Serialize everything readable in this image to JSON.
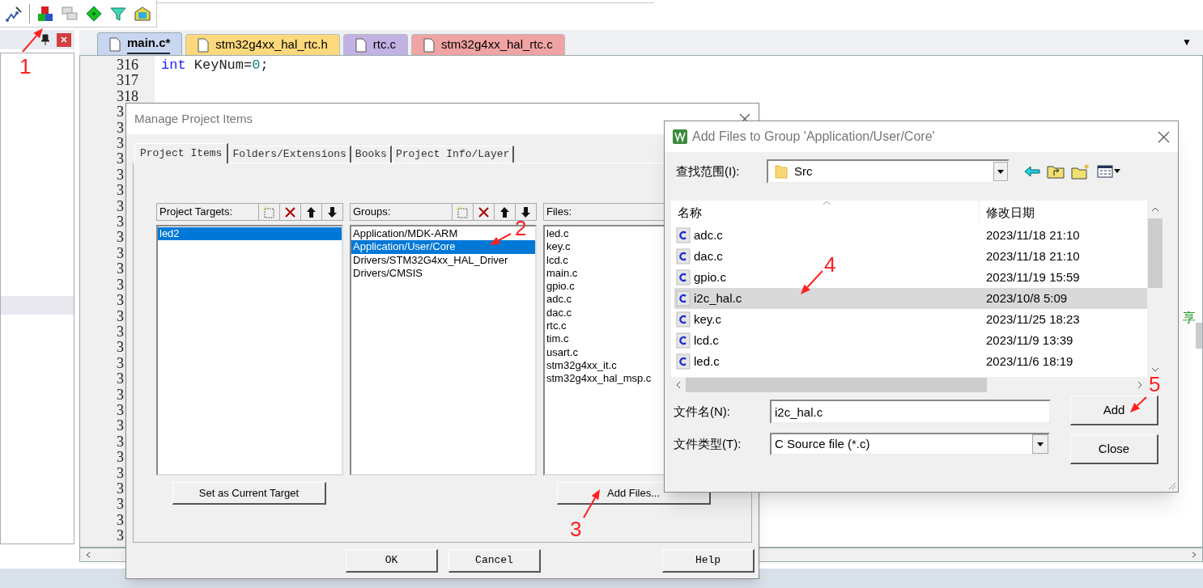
{
  "editor_tabs": [
    {
      "label": "main.c*",
      "selected": true,
      "color": "#c9d6f2"
    },
    {
      "label": "stm32g4xx_hal_rtc.h",
      "selected": false,
      "color": "#fcd97c"
    },
    {
      "label": "rtc.c",
      "selected": false,
      "color": "#c2b2e4"
    },
    {
      "label": "stm32g4xx_hal_rtc.c",
      "selected": false,
      "color": "#f0a3a3"
    }
  ],
  "tab_menu": "▼",
  "editor": {
    "line_numbers": [
      "316",
      "317",
      "318",
      "3",
      "3",
      "3",
      "3",
      "3",
      "3",
      "3",
      "3",
      "3",
      "3",
      "3",
      "3",
      "3",
      "3",
      "3",
      "3",
      "3",
      "3",
      "3",
      "3",
      "3",
      "3",
      "3",
      "3",
      "3",
      "3",
      "3",
      "3"
    ],
    "code": [
      {
        "text": "int",
        "kind": "keyword"
      },
      {
        "text": " KeyNum=",
        "kind": "plain"
      },
      {
        "text": "0",
        "kind": "number"
      },
      {
        "text": ";",
        "kind": "plain"
      }
    ],
    "side_text": "享"
  },
  "manage_dialog": {
    "title": "Manage Project Items",
    "tabs": [
      {
        "label": "Project Items",
        "selected": true
      },
      {
        "label": "Folders/Extensions",
        "selected": false
      },
      {
        "label": "Books",
        "selected": false
      },
      {
        "label": "Project Info/Layer",
        "selected": false
      }
    ],
    "targets": {
      "label": "Project Targets:",
      "items": [
        {
          "label": "led2",
          "selected": true
        }
      ]
    },
    "groups": {
      "label": "Groups:",
      "items": [
        {
          "label": "Application/MDK-ARM",
          "selected": false
        },
        {
          "label": "Application/User/Core",
          "selected": true
        },
        {
          "label": "Drivers/STM32G4xx_HAL_Driver",
          "selected": false
        },
        {
          "label": "Drivers/CMSIS",
          "selected": false
        }
      ]
    },
    "files": {
      "label": "Files:",
      "items": [
        "led.c",
        "key.c",
        "lcd.c",
        "main.c",
        "gpio.c",
        "adc.c",
        "dac.c",
        "rtc.c",
        "tim.c",
        "usart.c",
        "stm32g4xx_it.c",
        "stm32g4xx_hal_msp.c"
      ]
    },
    "set_target_button": "Set as Current Target",
    "add_files_button": "Add Files...",
    "buttons": [
      "OK",
      "Cancel",
      "Help"
    ]
  },
  "add_files_dialog": {
    "title": "Add Files to Group 'Application/User/Core'",
    "look_in_label": "查找范围(I):",
    "look_in_value": "Src",
    "columns": [
      "名称",
      "修改日期"
    ],
    "rows": [
      {
        "name": "adc.c",
        "date": "2023/11/18 21:10",
        "selected": false
      },
      {
        "name": "dac.c",
        "date": "2023/11/18 21:10",
        "selected": false
      },
      {
        "name": "gpio.c",
        "date": "2023/11/19 15:59",
        "selected": false
      },
      {
        "name": "i2c_hal.c",
        "date": "2023/10/8 5:09",
        "selected": true
      },
      {
        "name": "key.c",
        "date": "2023/11/25 18:23",
        "selected": false
      },
      {
        "name": "lcd.c",
        "date": "2023/11/9 13:39",
        "selected": false
      },
      {
        "name": "led.c",
        "date": "2023/11/6 18:19",
        "selected": false
      }
    ],
    "file_name_label": "文件名(N):",
    "file_name_value": "i2c_hal.c",
    "file_type_label": "文件类型(T):",
    "file_type_value": "C Source file (*.c)",
    "buttons": [
      "Add",
      "Close"
    ]
  },
  "annotations": [
    {
      "label": "1"
    },
    {
      "label": "2"
    },
    {
      "label": "3"
    },
    {
      "label": "4"
    },
    {
      "label": "5"
    }
  ]
}
